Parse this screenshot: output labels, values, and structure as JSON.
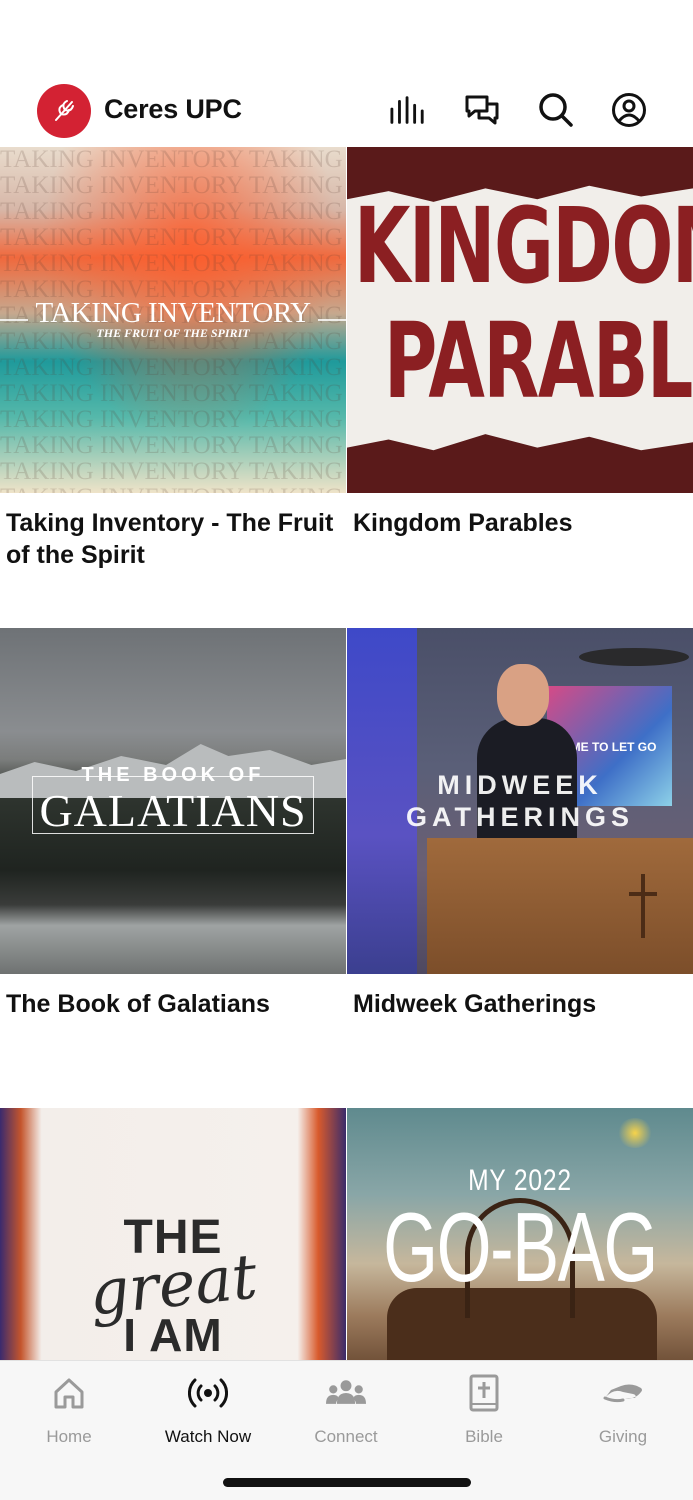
{
  "header": {
    "app_title": "Ceres UPC",
    "icons": [
      "audio-bars-icon",
      "chat-bubbles-icon",
      "search-icon",
      "profile-icon"
    ]
  },
  "series": [
    {
      "title": "Taking Inventory - The Fruit of the Spirit",
      "art_title": "TAKING INVENTORY",
      "art_subtitle": "THE FRUIT OF THE SPIRIT",
      "art_pattern": "TAKING INVENTORY TAKING INVENTORY"
    },
    {
      "title": "Kingdom Parables",
      "art_line1": "KINGDOM",
      "art_line2": "PARABLES"
    },
    {
      "title": "The Book of Galatians",
      "art_line1": "THE BOOK OF",
      "art_line2": "GALATIANS"
    },
    {
      "title": "Midweek Gatherings",
      "art_line1": "MIDWEEK",
      "art_line2": "GATHERINGS",
      "screen_text": "TIME TO LET GO"
    },
    {
      "title": "",
      "art_line1": "THE",
      "art_line2": "great",
      "art_line3": "I AM"
    },
    {
      "title": "",
      "art_line1": "MY 2022",
      "art_line2": "GO-BAG"
    }
  ],
  "tabbar": {
    "tabs": [
      {
        "label": "Home",
        "icon": "home-icon",
        "active": false
      },
      {
        "label": "Watch Now",
        "icon": "broadcast-icon",
        "active": true
      },
      {
        "label": "Connect",
        "icon": "group-icon",
        "active": false
      },
      {
        "label": "Bible",
        "icon": "bible-icon",
        "active": false
      },
      {
        "label": "Giving",
        "icon": "giving-hand-icon",
        "active": false
      }
    ]
  },
  "colors": {
    "brand": "#d32233",
    "active_tab": "#111111",
    "inactive_tab": "#9a9a9a"
  }
}
